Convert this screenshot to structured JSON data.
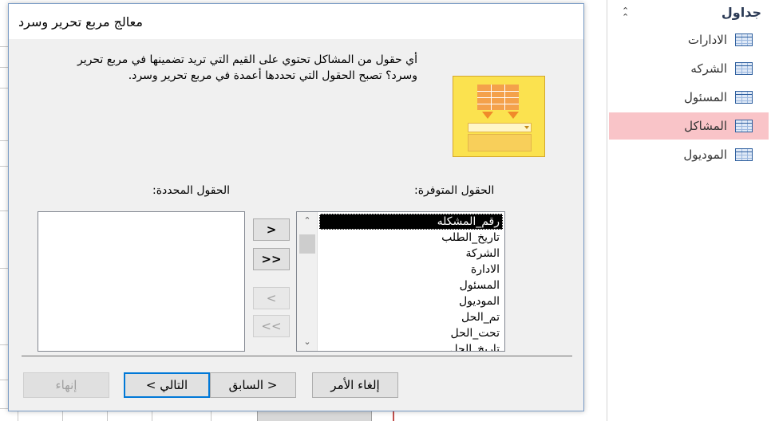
{
  "nav": {
    "header": "جداول",
    "items": [
      {
        "label": "الادارات",
        "active": false
      },
      {
        "label": "الشركه",
        "active": false
      },
      {
        "label": "المسئول",
        "active": false
      },
      {
        "label": "المشاكل",
        "active": true
      },
      {
        "label": "الموديول",
        "active": false
      }
    ]
  },
  "dialog": {
    "title": "معالج مربع تحرير وسرد",
    "instructions": "أي حقول من المشاكل تحتوي على القيم التي تريد تضمينها في مربع تحرير وسرد؟ تصبح الحقول التي تحددها أعمدة في مربع تحرير وسرد.",
    "available_label": "الحقول المتوفرة:",
    "selected_label": "الحقول المحددة:",
    "available_fields": [
      "رقم_المشكله",
      "تاريخ_الطلب",
      "الشركة",
      "الادارة",
      "المسئول",
      "الموديول",
      "تم_الحل",
      "تحت_الحل",
      "تاريخ_الحل"
    ],
    "selected_fields": [],
    "move_buttons": {
      "add_one": ">",
      "add_all": ">>",
      "remove_one": "<",
      "remove_all": "<<"
    },
    "buttons": {
      "cancel": "إلغاء الأمر",
      "back": "< السابق",
      "next": "التالي >",
      "finish": "إنهاء"
    }
  }
}
